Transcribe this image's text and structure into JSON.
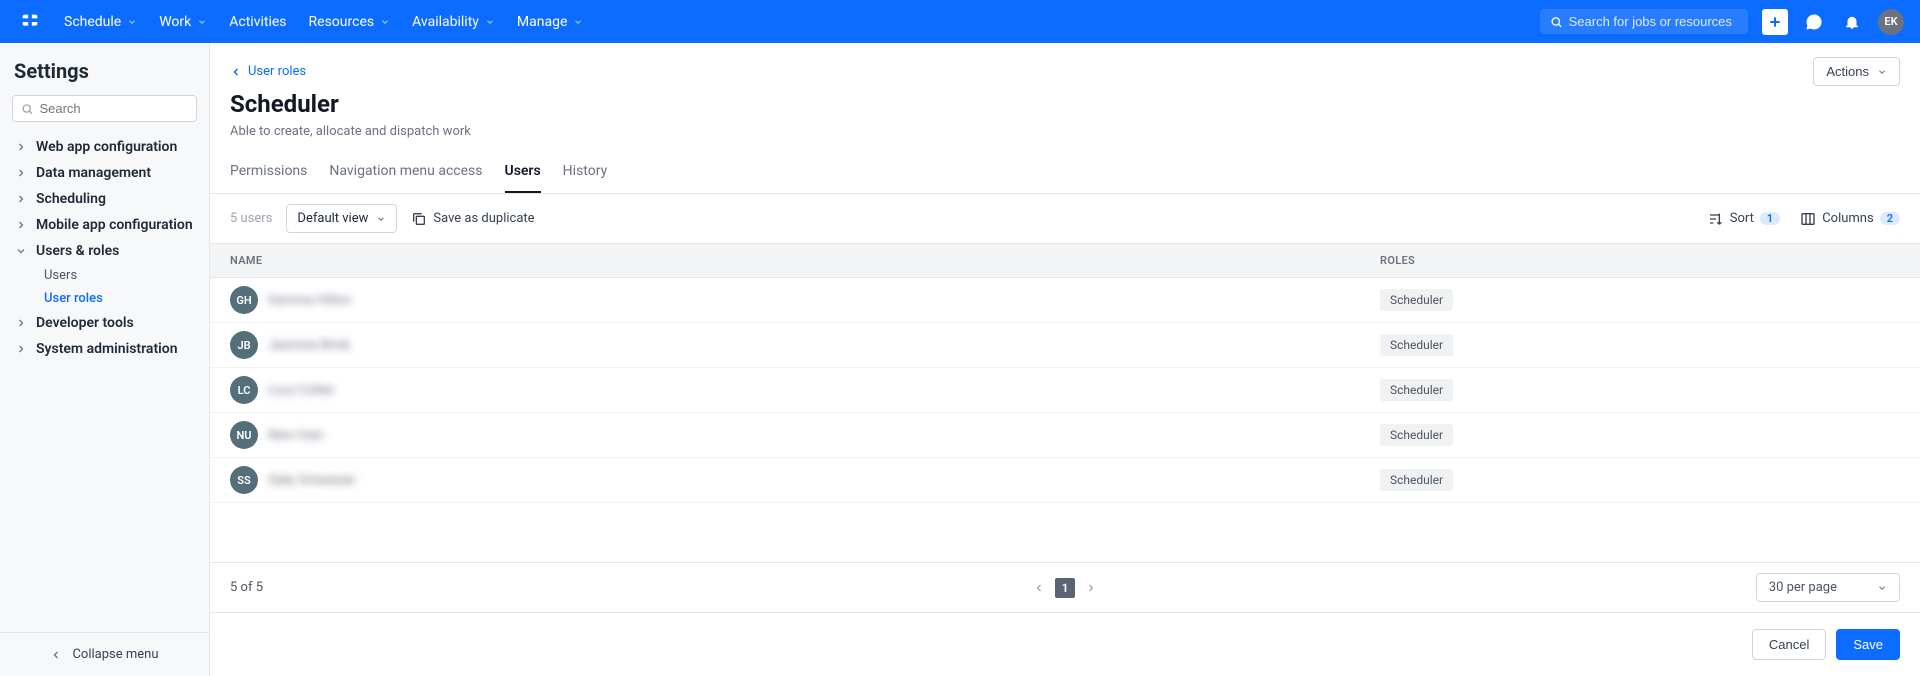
{
  "topnav": {
    "items": [
      "Schedule",
      "Work",
      "Activities",
      "Resources",
      "Availability",
      "Manage"
    ],
    "search_placeholder": "Search for jobs or resources",
    "avatar": "EK"
  },
  "sidebar": {
    "title": "Settings",
    "search_placeholder": "Search",
    "sections": [
      {
        "label": "Web app configuration",
        "expanded": false
      },
      {
        "label": "Data management",
        "expanded": false
      },
      {
        "label": "Scheduling",
        "expanded": false
      },
      {
        "label": "Mobile app configuration",
        "expanded": false
      },
      {
        "label": "Users & roles",
        "expanded": true,
        "children": [
          {
            "label": "Users",
            "active": false
          },
          {
            "label": "User roles",
            "active": true
          }
        ]
      },
      {
        "label": "Developer tools",
        "expanded": false
      },
      {
        "label": "System administration",
        "expanded": false
      }
    ],
    "collapse": "Collapse menu"
  },
  "header": {
    "breadcrumb": "User roles",
    "title": "Scheduler",
    "subtitle": "Able to create, allocate and dispatch work",
    "actions_label": "Actions"
  },
  "tabs": [
    {
      "label": "Permissions",
      "active": false
    },
    {
      "label": "Navigation menu access",
      "active": false
    },
    {
      "label": "Users",
      "active": true
    },
    {
      "label": "History",
      "active": false
    }
  ],
  "toolbar": {
    "count": "5 users",
    "view": "Default view",
    "save_dup": "Save as duplicate",
    "sort_label": "Sort",
    "sort_count": "1",
    "cols_label": "Columns",
    "cols_count": "2"
  },
  "table": {
    "headers": {
      "name": "NAME",
      "roles": "ROLES"
    },
    "rows": [
      {
        "initials": "GH",
        "name": "Gemma Hilton",
        "role": "Scheduler"
      },
      {
        "initials": "JB",
        "name": "Jasmine Brink",
        "role": "Scheduler"
      },
      {
        "initials": "LC",
        "name": "Lucy Collier",
        "role": "Scheduler"
      },
      {
        "initials": "NU",
        "name": "New User",
        "role": "Scheduler"
      },
      {
        "initials": "SS",
        "name": "Sally Scheduler",
        "role": "Scheduler"
      }
    ],
    "footer": {
      "count": "5 of 5",
      "page": "1",
      "per_page": "30 per page"
    }
  },
  "actions": {
    "cancel": "Cancel",
    "save": "Save"
  }
}
